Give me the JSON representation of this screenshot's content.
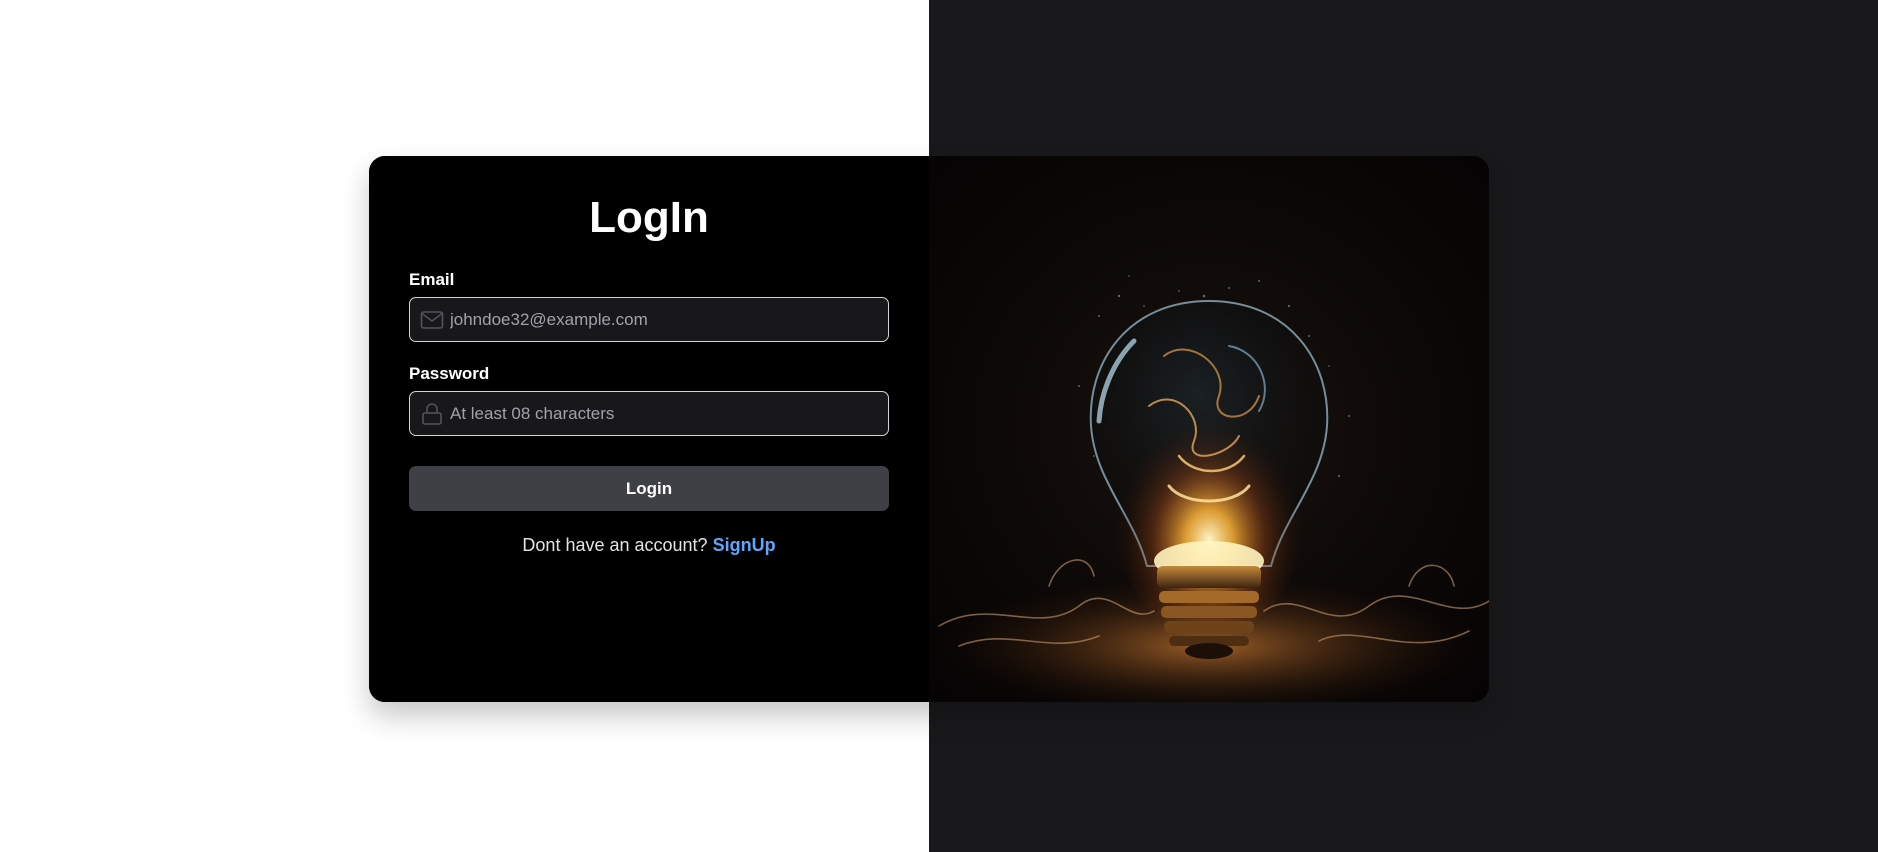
{
  "login": {
    "title": "LogIn",
    "email_label": "Email",
    "email_placeholder": "johndoe32@example.com",
    "password_label": "Password",
    "password_placeholder": "At least 08 characters",
    "login_button": "Login",
    "signup_prompt": "Dont have an account?",
    "signup_link": "SignUp"
  },
  "icons": {
    "email": "mail-icon",
    "password": "lock-icon"
  },
  "colors": {
    "panel_bg": "#000000",
    "input_bg": "#18181b",
    "input_border": "#d4d4d8",
    "button_bg": "#3f3f46",
    "link": "#60a5fa",
    "right_background": "#19191b"
  },
  "hero_image": {
    "subject": "glowing lightbulb with fire and smoke"
  }
}
